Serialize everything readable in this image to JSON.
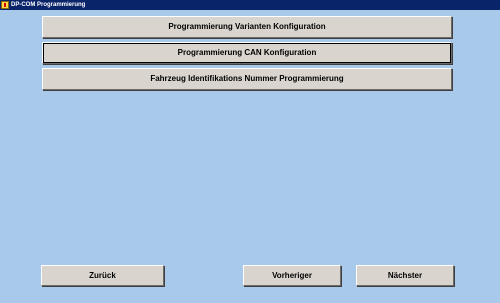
{
  "window": {
    "title": "DP-COM Programmierung"
  },
  "main": {
    "buttons": [
      {
        "label": "Programmierung Varianten Konfiguration"
      },
      {
        "label": "Programmierung CAN Konfiguration"
      },
      {
        "label": "Fahrzeug Identifikations Nummer Programmierung"
      }
    ]
  },
  "footer": {
    "back_label": "Zurück",
    "prev_label": "Vorheriger",
    "next_label": "Nächster"
  },
  "colors": {
    "background": "#a9c9eb",
    "button_face": "#d9d5ce",
    "titlebar": "#0a246a"
  }
}
